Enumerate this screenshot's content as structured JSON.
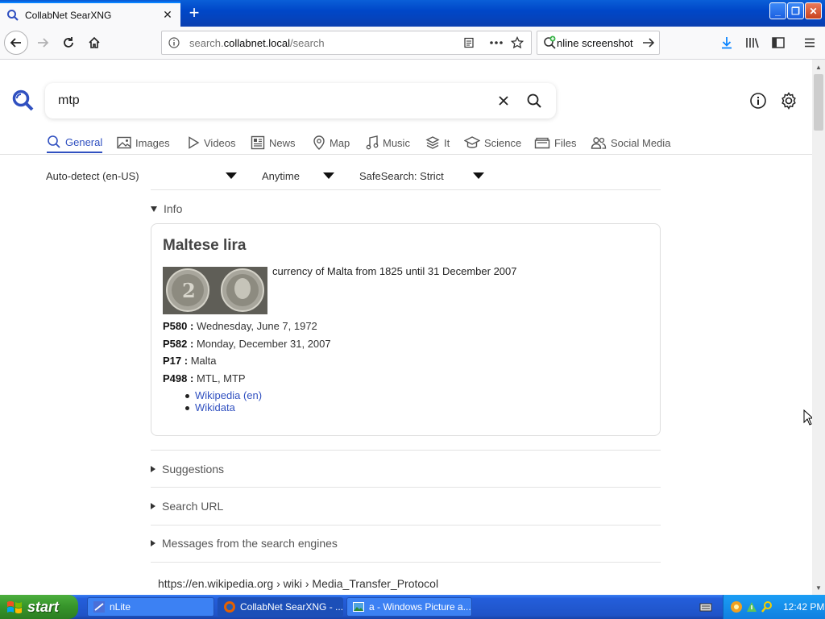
{
  "browser": {
    "tab_title": "CollabNet SearXNG",
    "url_prefix": "search.",
    "url_domain": "collabnet.local",
    "url_path": "/search",
    "extension_text": "nline screenshot"
  },
  "search": {
    "query": "mtp"
  },
  "categories": [
    {
      "label": "General",
      "icon": "search-icon"
    },
    {
      "label": "Images",
      "icon": "image-icon"
    },
    {
      "label": "Videos",
      "icon": "play-icon"
    },
    {
      "label": "News",
      "icon": "newspaper-icon"
    },
    {
      "label": "Map",
      "icon": "map-pin-icon"
    },
    {
      "label": "Music",
      "icon": "music-icon"
    },
    {
      "label": "It",
      "icon": "layers-icon"
    },
    {
      "label": "Science",
      "icon": "graduation-cap-icon"
    },
    {
      "label": "Files",
      "icon": "files-icon"
    },
    {
      "label": "Social Media",
      "icon": "people-icon"
    }
  ],
  "filters": {
    "language": "Auto-detect (en-US)",
    "time_range": "Anytime",
    "safesearch": "SafeSearch: Strict"
  },
  "infobox": {
    "section_label": "Info",
    "title": "Maltese lira",
    "description": "currency of Malta from 1825 until 31 December 2007",
    "attributes": [
      {
        "key": "P580 :",
        "value": "Wednesday, June 7, 1972"
      },
      {
        "key": "P582 :",
        "value": "Monday, December 31, 2007"
      },
      {
        "key": "P17 :",
        "value": "Malta"
      },
      {
        "key": "P498 :",
        "value": "MTL, MTP"
      }
    ],
    "links": [
      "Wikipedia (en)",
      "Wikidata"
    ]
  },
  "sections": {
    "suggestions": "Suggestions",
    "search_url": "Search URL",
    "messages": "Messages from the search engines"
  },
  "result": {
    "url": "https://en.wikipedia.org  › wiki › Media_Transfer_Protocol"
  },
  "taskbar": {
    "start_label": "start",
    "tasks": [
      "nLite",
      "CollabNet SearXNG - ...",
      "a - Windows Picture a..."
    ],
    "clock": "12:42 PM"
  },
  "colors": {
    "accent": "#3050c0",
    "xp_blue": "#245edb",
    "xp_green": "#36942a"
  }
}
